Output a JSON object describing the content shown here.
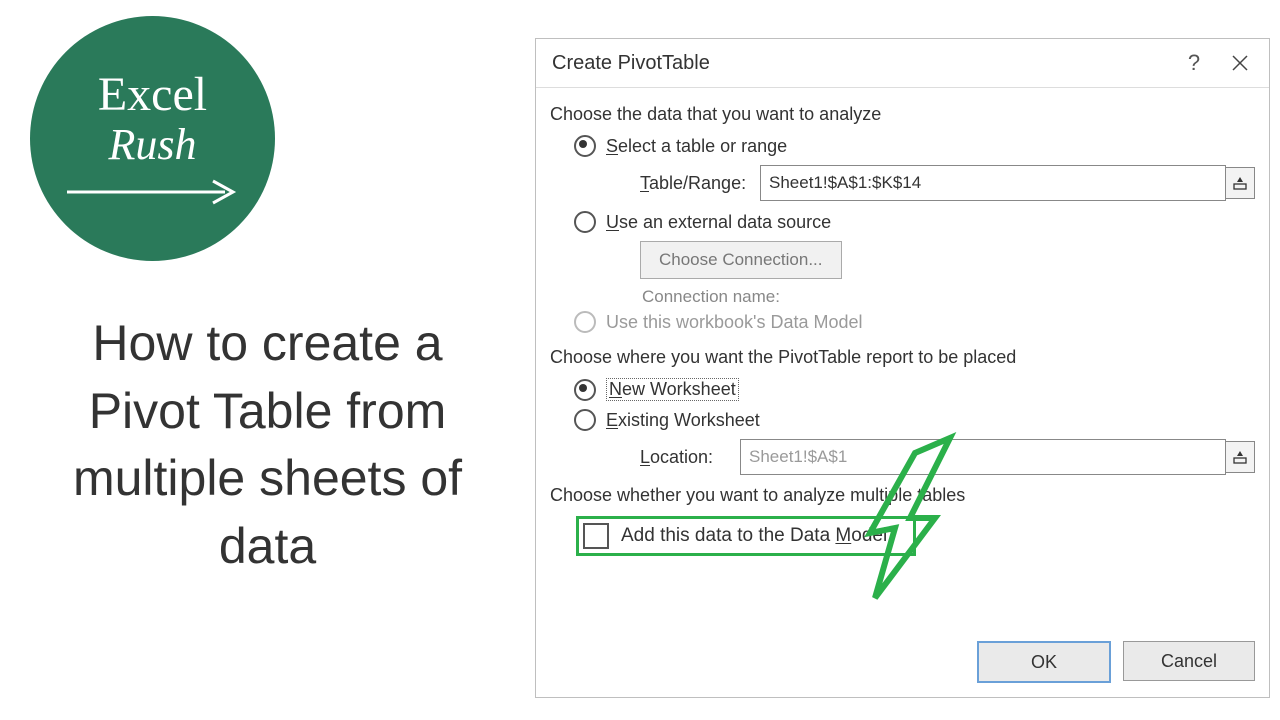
{
  "logo": {
    "line1": "Excel",
    "line2": "Rush"
  },
  "headline": "How to create a Pivot Table from multiple sheets of data",
  "dialog": {
    "title": "Create PivotTable",
    "section1": "Choose the data that you want to analyze",
    "opt_select_pre": "S",
    "opt_select_post": "elect a table or range",
    "range_label_pre": "T",
    "range_label_post": "able/Range:",
    "range_value": "Sheet1!$A$1:$K$14",
    "opt_external_pre": "U",
    "opt_external_post": "se an external data source",
    "choose_conn": "Choose Connection...",
    "conn_name": "Connection name:",
    "opt_datamodel": "Use this workbook's Data Model",
    "section2": "Choose where you want the PivotTable report to be placed",
    "opt_new_pre": "N",
    "opt_new_post": "ew Worksheet",
    "opt_exist_pre": "E",
    "opt_exist_post": "xisting Worksheet",
    "loc_label_pre": "L",
    "loc_label_post": "ocation:",
    "loc_value": "Sheet1!$A$1",
    "section3": "Choose whether you want to analyze multiple tables",
    "check_add_pre": "Add this data to the Data ",
    "check_add_u": "M",
    "check_add_post": "odel",
    "ok": "OK",
    "cancel": "Cancel"
  }
}
